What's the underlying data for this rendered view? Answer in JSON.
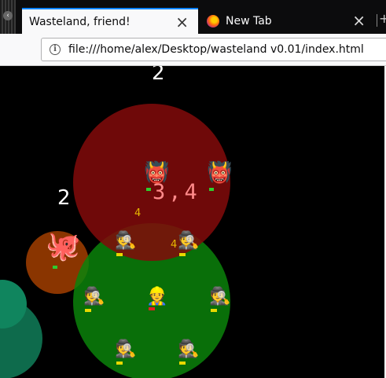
{
  "browser": {
    "tabs": [
      {
        "title": "Wasteland, friend!",
        "active": true
      },
      {
        "title": "New Tab",
        "active": false
      }
    ],
    "url": "file:///home/alex/Desktop/wasteland v0.01/index.html",
    "close_glyph": "×"
  },
  "game": {
    "top_number": "2",
    "left_number": "2",
    "red_zone_label": "3,4",
    "yellow_label_1": "4",
    "yellow_label_2": "4",
    "colors": {
      "background": "#000000",
      "red_zone": "#7a0a0a",
      "green_zone": "#0a6e0a",
      "orange_zone": "#8a3500",
      "teal_zone": "#0e7a5a",
      "zone_label": "#ff8a8a",
      "yellow_label": "#e8b800",
      "health_green": "#2ecc2e",
      "health_yellow": "#e8d800",
      "health_red": "#dd2222"
    },
    "sprites": {
      "demon": "👹",
      "octopus": "🐙",
      "spy": "🕵",
      "hero": "👷"
    }
  }
}
